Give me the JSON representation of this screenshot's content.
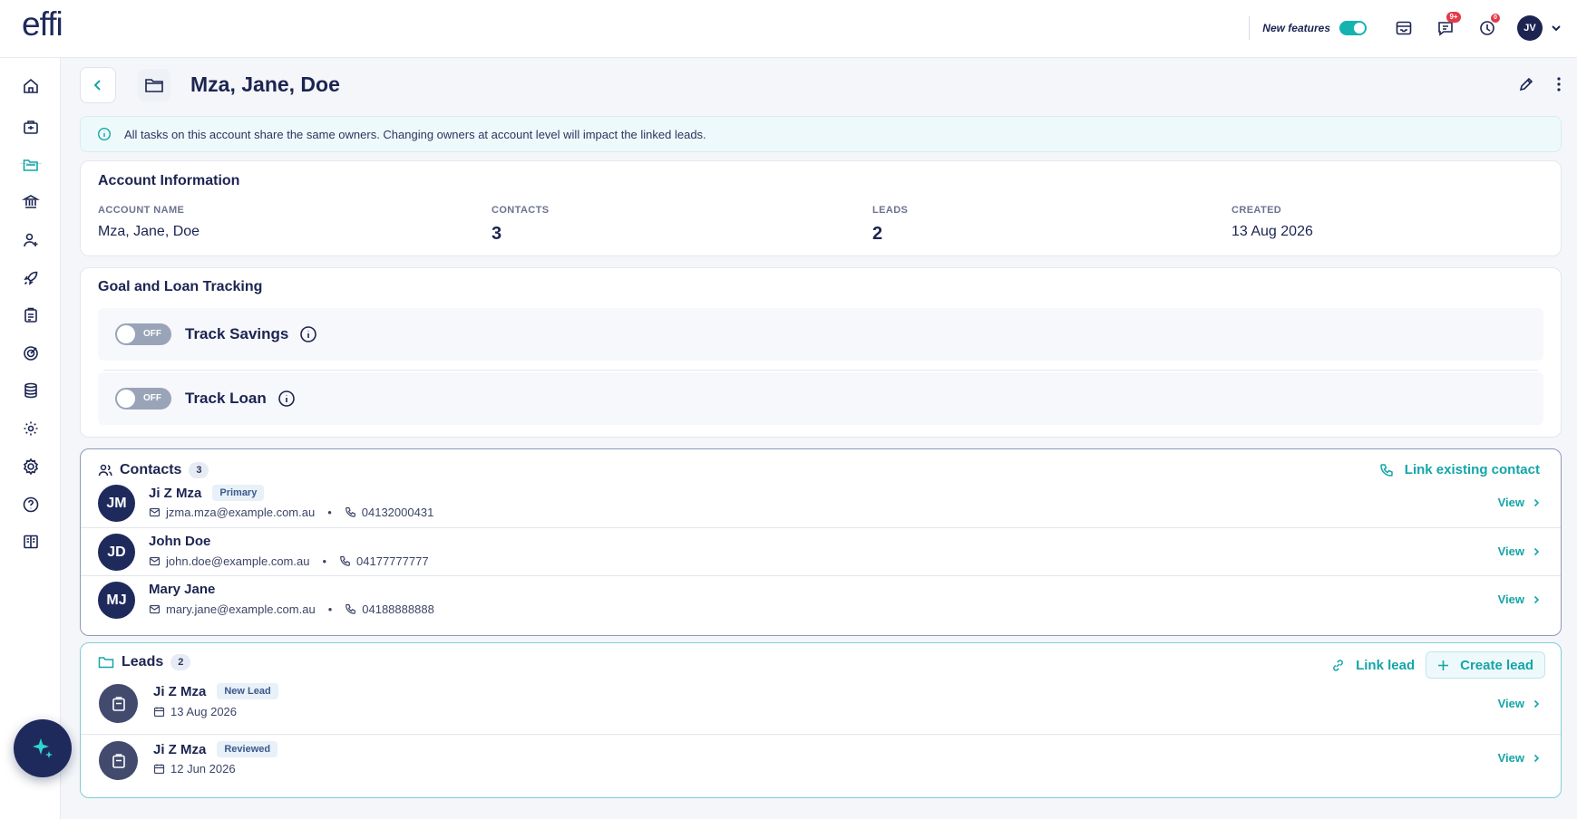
{
  "app": {
    "logo": "effi"
  },
  "topbar": {
    "new_features_label": "New features",
    "new_features_on": true,
    "messages_badge": "9+",
    "alerts_badge": "0",
    "user_initials": "JV"
  },
  "sidebar": {
    "items": [
      "home-icon",
      "briefcase-icon",
      "folder-icon",
      "bank-icon",
      "user-plus-icon",
      "rocket-icon",
      "clipboard-icon",
      "target-icon",
      "database-icon",
      "settings-cog-icon",
      "gear-icon",
      "help-icon",
      "book-icon"
    ],
    "active": "folder-icon"
  },
  "header": {
    "title": "Mza, Jane, Doe"
  },
  "banner": {
    "text": "All tasks on this account share the same owners. Changing owners at account level will impact the linked leads."
  },
  "account": {
    "title": "Account Information",
    "fields": [
      {
        "label": "ACCOUNT NAME",
        "value": "Mza, Jane, Doe"
      },
      {
        "label": "CONTACTS",
        "value": "3"
      },
      {
        "label": "LEADS",
        "value": "2"
      },
      {
        "label": "CREATED",
        "value": "13 Aug 2026"
      }
    ]
  },
  "goals": {
    "title": "Goal and Loan Tracking",
    "items": [
      {
        "label": "Track Savings",
        "state": "OFF"
      },
      {
        "label": "Track Loan",
        "state": "OFF"
      }
    ]
  },
  "contacts": {
    "title": "Contacts",
    "count": "3",
    "link_label": "Link existing contact",
    "view_label": "View",
    "rows": [
      {
        "initials": "JM",
        "name": "Ji Z Mza",
        "tag": "Primary",
        "email": "jzma.mza@example.com.au",
        "phone": "04132000431"
      },
      {
        "initials": "JD",
        "name": "John Doe",
        "tag": "",
        "email": "john.doe@example.com.au",
        "phone": "04177777777"
      },
      {
        "initials": "MJ",
        "name": "Mary Jane",
        "tag": "",
        "email": "mary.jane@example.com.au",
        "phone": "04188888888"
      }
    ]
  },
  "leads": {
    "title": "Leads",
    "count": "2",
    "link_label": "Link lead",
    "create_label": "Create lead",
    "view_label": "View",
    "rows": [
      {
        "name": "Ji Z Mza",
        "status": "New Lead",
        "date": "13 Aug 2026"
      },
      {
        "name": "Ji Z Mza",
        "status": "Reviewed",
        "date": "12 Jun 2026"
      }
    ]
  },
  "colors": {
    "accent": "#14a5a8",
    "navy": "#1c2451",
    "badge": "#e23a4a"
  }
}
